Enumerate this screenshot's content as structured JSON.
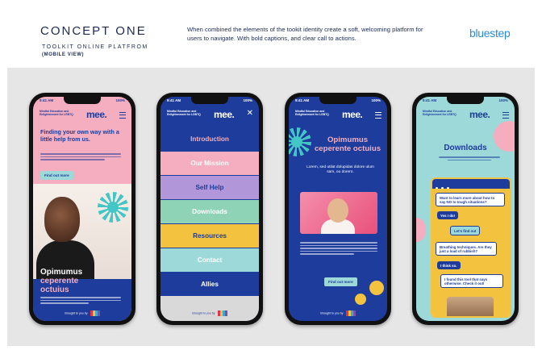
{
  "header": {
    "title": "CONCEPT ONE",
    "subtitle": "TOOLKIT ONLINE PLATFROM",
    "view": "(MOBILE VIEW)",
    "intro": "When combined the elements of the tookit identity create a soft, welcoming platform for users to navigate. With bold captions, and clear call to actions.",
    "brand": "bluestep"
  },
  "status": {
    "time": "9:41 AM",
    "battery": "100%"
  },
  "app": {
    "tagline": "Mindful Education and Enlightenment for LGBTQ",
    "logo": "mee."
  },
  "phone1": {
    "headline": "Finding your own way with a little help from us.",
    "button": "Find out more",
    "caption_lines": [
      "Opimumus",
      "ceperente",
      "octuius"
    ]
  },
  "phone2": {
    "menu": [
      "Introduction",
      "Our Mission",
      "Self Help",
      "Downloads",
      "Resources",
      "Contact",
      "Allies"
    ]
  },
  "phone3": {
    "title": "Opimumus ceperente octuius",
    "subtitle": "Lorem, sed utilat dolupidas dolore ulum sam, ou dorero.",
    "button": "Find out more"
  },
  "phone4": {
    "title": "Downloads",
    "chat": [
      "Want to learn more about how to say NO to tough situations?",
      "Yes I do!",
      "Let's find out",
      "Breathing techniques. Are they just a load of rubbish?",
      "I think so.",
      "I found this tool that says otherwise. Check it out!"
    ]
  },
  "footer": {
    "supported": "Brought to you by"
  },
  "colors": {
    "pink": "#f4aebf",
    "navy": "#1d3c9c",
    "teal": "#9ed9d9",
    "yellow": "#f3c33f",
    "lilac": "#b197d9",
    "mint": "#8fd3b6",
    "brand": "#2a8ad8"
  },
  "icons": [
    "hamburger-menu-icon",
    "close-icon",
    "chat-window-dots-icon",
    "sunburst-wheel-icon"
  ]
}
